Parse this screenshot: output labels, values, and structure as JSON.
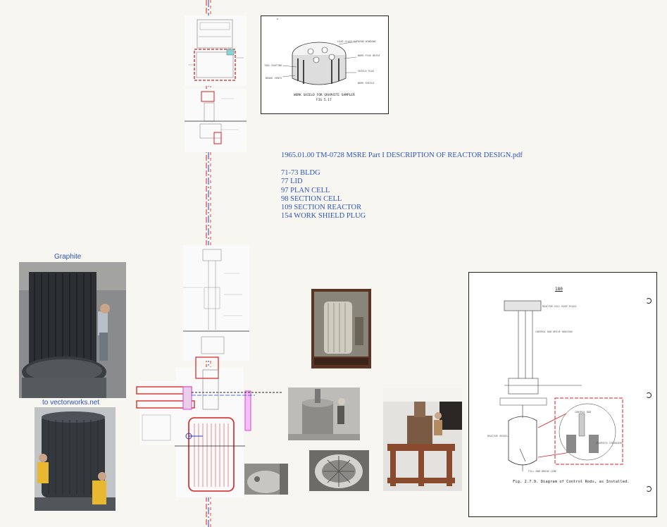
{
  "notes": {
    "document_title": "1965.01.00 TM-0728 MSRE Part I DESCRIPTION OF REACTOR DESIGN.pdf",
    "pages": [
      "71-73 BLDG",
      "77 LID",
      "97 PLAN CELL",
      "98 SECTION CELL",
      "109 SECTION REACTOR",
      "154 WORK SHIELD PLUG"
    ]
  },
  "links": {
    "graphite": "Graphite",
    "vectorworks": "to vectorworks.net"
  },
  "work_shield": {
    "caption_line1": "WORK SHIELD FOR GRAPHITE SAMPLER",
    "caption_line2": "FIG 5.17",
    "labels": [
      "LEAD GLASS VIEWING WINDOWS",
      "WORK PLUG DRIVE",
      "SHIELD PLUG",
      "WORK SHIELD",
      "TOOL ROUTING",
      "BRAKE VENTS"
    ]
  },
  "control_rods": {
    "page_number": "180",
    "caption": "Fig. 2.7.9. Diagram of Control Rods, as Installed.",
    "labels": [
      "REACTOR CELL ROOF PLUGS",
      "CONTROL ROD DRIVE HOUSING",
      "REACTOR VESSEL",
      "FILL AND DRAIN LINE",
      "CONTROL ROD",
      "GRAPHITE STRINGERS"
    ]
  },
  "colors": {
    "link": "#2e54b8",
    "markup_red": "#d42020",
    "markup_blue": "#2a3fd0",
    "markup_magenta": "#e040e0",
    "background": "#f7f6f0"
  }
}
